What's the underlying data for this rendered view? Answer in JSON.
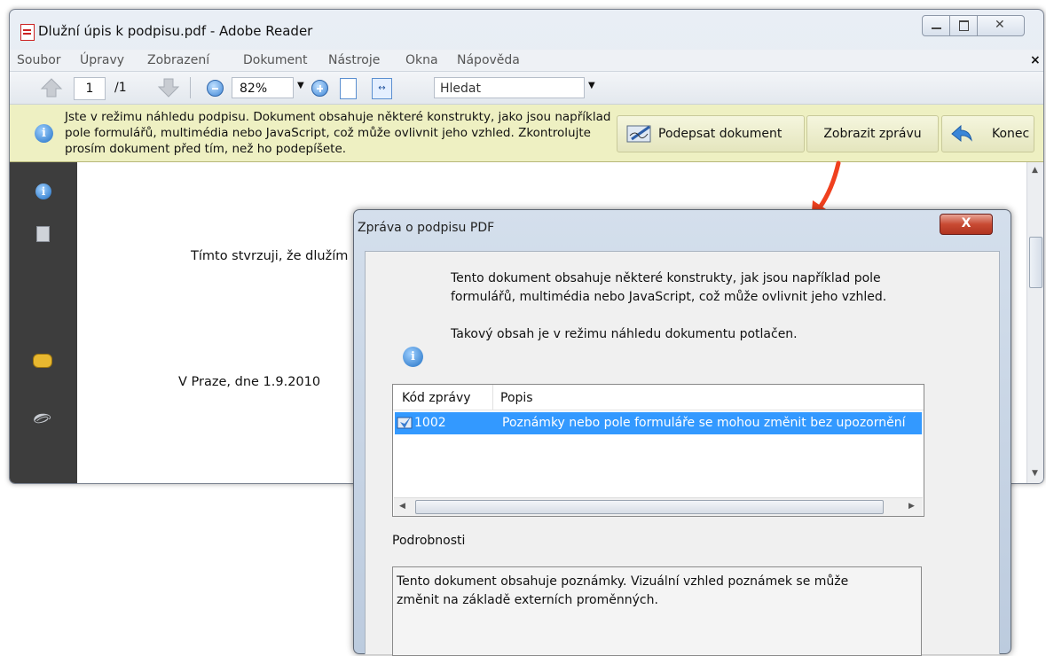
{
  "window": {
    "title": "Dlužní úpis k podpisu.pdf - Adobe Reader",
    "close_glyph": "✕"
  },
  "menu": {
    "items": [
      "Soubor",
      "Úpravy",
      "Zobrazení",
      "Dokument",
      "Nástroje",
      "Okna",
      "Nápověda"
    ],
    "close_glyph": "×"
  },
  "toolbar": {
    "page_current": "1",
    "page_total": "/1",
    "zoom": "82%",
    "search_placeholder": "Hledat"
  },
  "infobar": {
    "message": "Jste v režimu náhledu podpisu. Dokument obsahuje některé konstrukty, jako jsou například pole formulářů, multimédia nebo JavaScript, což může ovlivnit jeho vzhled. Zkontrolujte prosím dokument před tím, než ho podepíšete.",
    "sign_label": "Podepsat dokument",
    "report_label": "Zobrazit zprávu",
    "end_label": "Konec"
  },
  "document": {
    "line1": "Tímto stvrzuji, že dlužím",
    "line2": "V Praze, dne 1.9.2010"
  },
  "dialog": {
    "title": "Zpráva o podpisu PDF",
    "close_glyph": "X",
    "message_line1": "Tento dokument obsahuje některé konstrukty, jak jsou například pole",
    "message_line2": "formulářů, multimédia nebo JavaScript, což může ovlivnit jeho vzhled.",
    "message_line3": "Takový obsah je v režimu náhledu dokumentu potlačen.",
    "columns": [
      "Kód zprávy",
      "Popis"
    ],
    "rows": [
      {
        "code": "1002",
        "description": "Poznámky nebo pole formuláře se mohou změnit bez upozornění"
      }
    ],
    "details_label": "Podrobnosti",
    "details_line1": "Tento dokument obsahuje poznámky. Vizuální vzhled poznámek se může",
    "details_line2": "změnit na základě externích proměnných."
  },
  "colors": {
    "selection": "#3399ff",
    "annotation_arrow": "#f0401e",
    "infobar": "#eef0c2",
    "left_panel": "#3d3d3d"
  }
}
